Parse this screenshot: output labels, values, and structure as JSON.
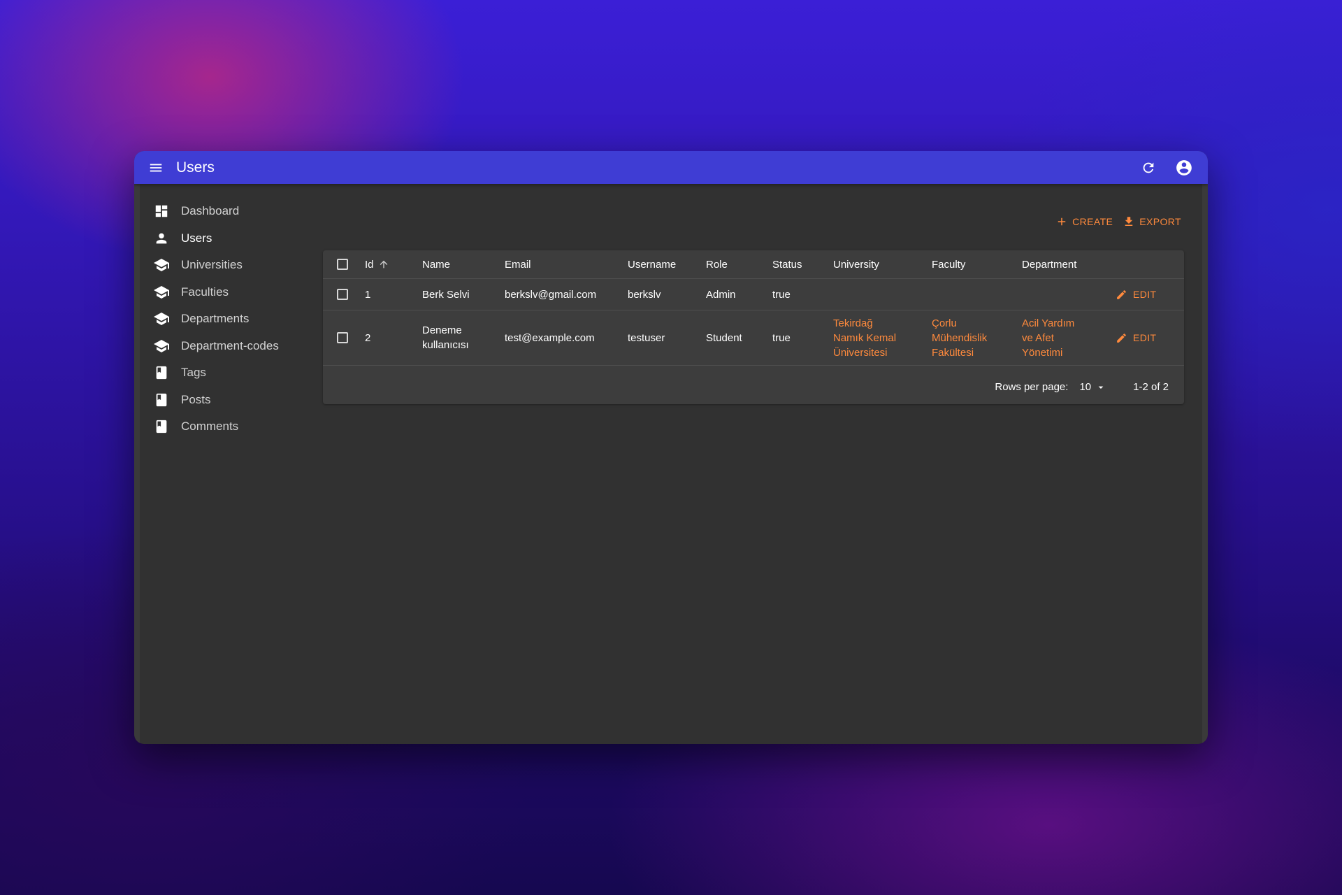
{
  "appbar": {
    "title": "Users",
    "icons": {
      "menu": "menu-icon",
      "refresh": "refresh-icon",
      "account": "account-circle-icon"
    },
    "color": "#3f3dd4"
  },
  "sidebar": {
    "items": [
      {
        "label": "Dashboard",
        "icon": "dashboard-icon"
      },
      {
        "label": "Users",
        "icon": "person-icon",
        "active": true
      },
      {
        "label": "Universities",
        "icon": "school-icon"
      },
      {
        "label": "Faculties",
        "icon": "school-icon"
      },
      {
        "label": "Departments",
        "icon": "school-icon"
      },
      {
        "label": "Department-codes",
        "icon": "school-icon"
      },
      {
        "label": "Tags",
        "icon": "bookmark-icon"
      },
      {
        "label": "Posts",
        "icon": "bookmark-icon"
      },
      {
        "label": "Comments",
        "icon": "bookmark-icon"
      }
    ]
  },
  "actions": {
    "create_label": "CREATE",
    "export_label": "EXPORT",
    "accent": "#ff8a3d"
  },
  "table": {
    "columns": [
      "Id",
      "Name",
      "Email",
      "Username",
      "Role",
      "Status",
      "University",
      "Faculty",
      "Department"
    ],
    "sorted_column": "Id",
    "sort_direction": "ascending",
    "rows": [
      {
        "id": "1",
        "name": "Berk Selvi",
        "email": "berkslv@gmail.com",
        "username": "berkslv",
        "role": "Admin",
        "status": "true",
        "university": "",
        "faculty": "",
        "department": "",
        "edit_label": "EDIT"
      },
      {
        "id": "2",
        "name": "Deneme kullanıcısı",
        "email": "test@example.com",
        "username": "testuser",
        "role": "Student",
        "status": "true",
        "university": "Tekirdağ Namık Kemal Üniversitesi",
        "faculty": "Çorlu Mühendislik Fakültesi",
        "department": "Acil Yardım ve Afet Yönetimi",
        "edit_label": "EDIT"
      }
    ]
  },
  "pagination": {
    "rows_per_page_label": "Rows per page:",
    "rows_per_page": "10",
    "range": "1-2 of 2"
  }
}
